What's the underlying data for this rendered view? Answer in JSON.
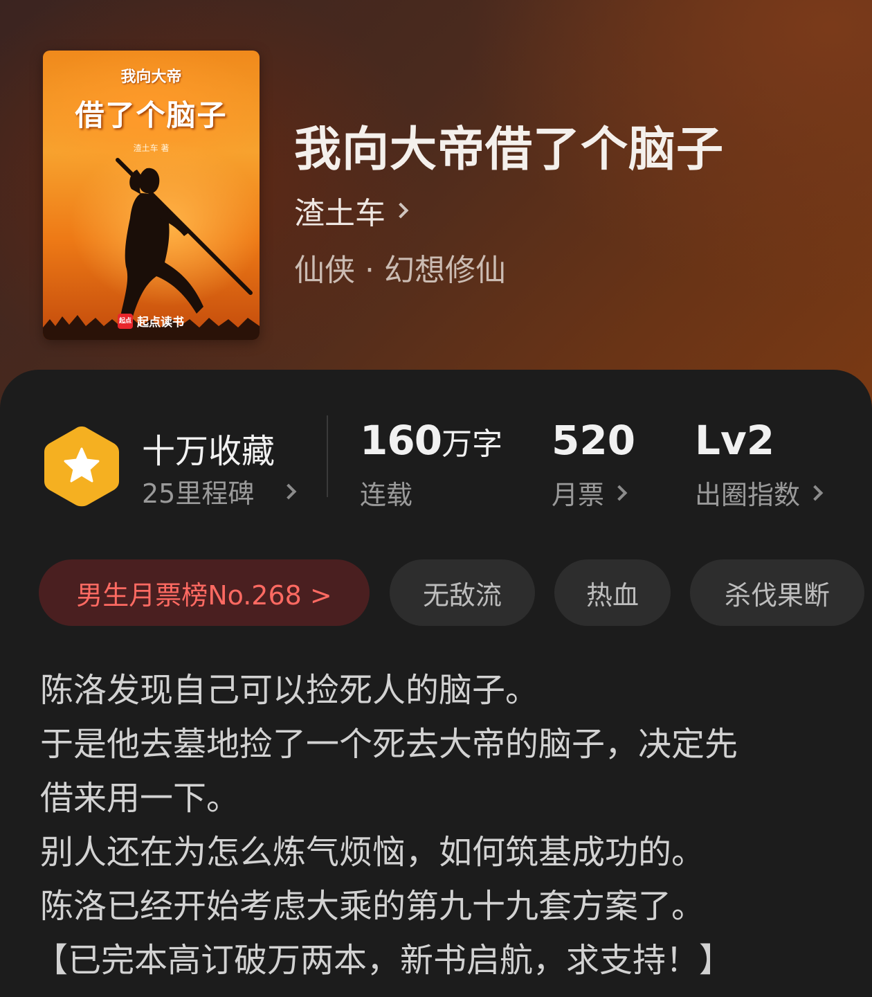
{
  "book": {
    "title": "我向大帝借了个脑子",
    "author": "渣土车",
    "genre": "仙侠 · 幻想修仙",
    "cover": {
      "subtitle": "我向大帝",
      "title": "借了个脑子",
      "author_line": "渣土车 著",
      "brand_mark": "起点",
      "brand_name": "起点读书"
    }
  },
  "stats": {
    "collection": {
      "title": "十万收藏",
      "sub": "25里程碑",
      "icon": "star-hexagon-icon"
    },
    "words": {
      "value": "160",
      "unit": "万字",
      "sub": "连载"
    },
    "monthly": {
      "value": "520",
      "sub": "月票"
    },
    "influence": {
      "value": "Lv2",
      "sub": "出圈指数"
    }
  },
  "tags": {
    "rank": "男生月票榜No.268 >",
    "items": [
      "无敌流",
      "热血",
      "杀伐果断"
    ]
  },
  "description": {
    "lines": [
      "陈洛发现自己可以捡死人的脑子。",
      "于是他去墓地捡了一个死去大帝的脑子，决定先",
      "借来用一下。",
      "别人还在为怎么炼气烦恼，如何筑基成功的。",
      "陈洛已经开始考虑大乘的第九十九套方案了。",
      "【已完本高订破万两本，新书启航，求支持！】"
    ]
  },
  "colors": {
    "accent_rank": "#ff6a62",
    "badge": "#f5b021",
    "panel": "#1c1c1c"
  }
}
